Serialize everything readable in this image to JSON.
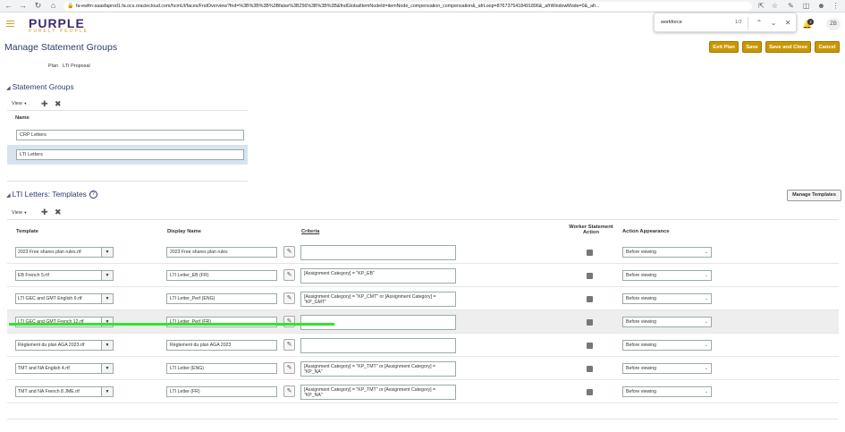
{
  "browser": {
    "url": "fa-ewfm-saasfaprod1.fa.ocs.oraclecloud.com/hcmUI/faces/FndOverview?fnd=%3B%3B%3B%3Bfalse%3B256%3B%3B%3B&fndGlobalItemNodeId=itemNode_compensation_compensation&_afrLoop=8767375418491896&_afrWindowMode=0&_afr...",
    "find": {
      "query": "workforce",
      "count": "1/2"
    }
  },
  "app": {
    "logo": "PURPLE",
    "logo_tagline": "PURELY PEOPLE",
    "notification_count": "2",
    "avatar_initials": "ZB"
  },
  "page": {
    "title": "Manage Statement Groups",
    "plan_label": "Plan",
    "plan_value": "LTI Proposal",
    "buttons": {
      "exit_plan": "Exit Plan",
      "save": "Save",
      "save_and_close": "Save and Close",
      "cancel": "Cancel"
    }
  },
  "statement_groups": {
    "title": "Statement Groups",
    "view_label": "View",
    "column_name": "Name",
    "rows": [
      "CRP Letters",
      "LTI Letters"
    ],
    "selected_index": 1
  },
  "templates": {
    "title": "LTI Letters: Templates",
    "view_label": "View",
    "manage_button": "Manage Templates",
    "columns": {
      "template": "Template",
      "display_name": "Display Name",
      "criteria": "Criteria",
      "worker_statement_action": "Worker Statement Action",
      "action_appearance": "Action Appearance"
    },
    "rows": [
      {
        "template": "2023 Free shares plan rules.rtf",
        "display_name": "2023 Free shares plan rules",
        "criteria": "",
        "appearance": "Before viewing"
      },
      {
        "template": "EB French 5.rtf",
        "display_name": "LTI Letter_EB (FR)",
        "criteria": "[Assignment Category] = \"KP_EB\"",
        "appearance": "Before viewing"
      },
      {
        "template": "LTI GEC and GMT English 9.rtf",
        "display_name": "LTI Letter_Perf (ENG)",
        "criteria": "[Assignment Category] = \"KP_CMT\" or [Assignment Category] = \"KP_GMT\"",
        "appearance": "Before viewing"
      },
      {
        "template": "LTI GEC and GMT French 12.rtf",
        "display_name": "LTI Letter_Perf (FR)",
        "criteria": "",
        "appearance": "Before viewing"
      },
      {
        "template": "Règlement du plan AGA 2023.rtf",
        "display_name": "Règlement du plan AGA 2023",
        "criteria": "",
        "appearance": "Before viewing"
      },
      {
        "template": "TMT and NA English 4.rtf",
        "display_name": "LTI Letter (ENG)",
        "criteria": "[Assignment Category] = \"KP_TMT\" or [Assignment Category] = \"KP_NA\"",
        "appearance": "Before viewing"
      },
      {
        "template": "TMT and NA French 8 JME.rtf",
        "display_name": "LTI Letter (FR)",
        "criteria": "[Assignment Category] = \"KP_TMT\" or [Assignment Category] = \"KP_NA\"",
        "appearance": "Before viewing"
      }
    ],
    "highlighted_index": 3
  },
  "colors": {
    "accent": "#c99700",
    "brand_purple": "#3b2a6b",
    "title_blue": "#2d3b6b",
    "highlight_green": "#2ee52e"
  }
}
